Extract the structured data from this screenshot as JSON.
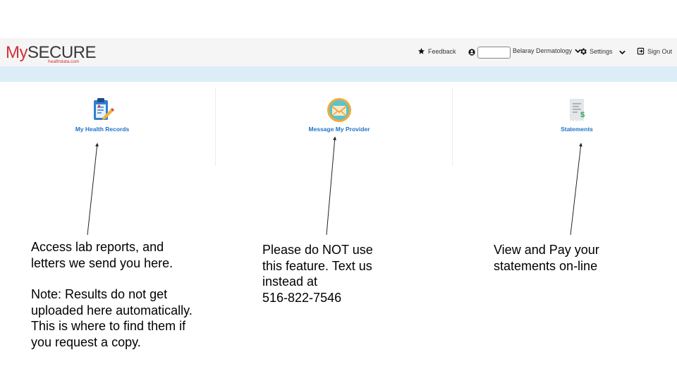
{
  "header": {
    "logo_my": "My",
    "logo_secure": "SECURE",
    "logo_sub": "healthdata.com",
    "feedback_label": "Feedback",
    "practice_name": "Belaray Dermatology",
    "settings_label": "Settings",
    "signout_label": "Sign Out",
    "icons": {
      "feedback": "star-icon",
      "user": "user-circle-icon",
      "practice_dropdown": "chevron-down-icon",
      "settings": "gear-icon",
      "settings_dropdown": "chevron-down-icon",
      "signout": "sign-out-icon"
    }
  },
  "tiles": [
    {
      "label": "My Health Records",
      "icon": "clipboard-pencil-icon"
    },
    {
      "label": "Message My Provider",
      "icon": "envelope-icon"
    },
    {
      "label": "Statements",
      "icon": "receipt-dollar-icon"
    }
  ],
  "annotations": {
    "records": {
      "line1": "Access lab reports, and\nletters we send you here.",
      "line2": "Note: Results do not get\nuploaded here automatically.\nThis is where to find them if\nyou request a copy."
    },
    "message": "Please do NOT use\nthis feature.  Text us\ninstead at\n516-822-7546",
    "statements": "View and Pay your\nstatements on-line"
  },
  "colors": {
    "brand_red": "#d0313a",
    "link_blue": "#1f73c6",
    "band_blue": "#dcedf8",
    "header_bg": "#f5f5f5"
  }
}
